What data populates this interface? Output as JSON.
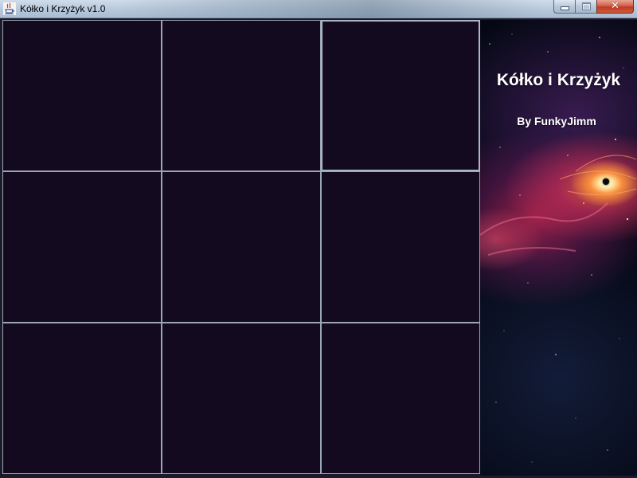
{
  "window": {
    "title": "Kółko i Krzyżyk v1.0",
    "app_icon": "java-cup-icon",
    "caption_buttons": {
      "minimize_icon": "minimize-icon",
      "maximize_icon": "maximize-icon",
      "close_icon": "close-icon",
      "close_glyph": "✕"
    }
  },
  "board": {
    "rows": 3,
    "columns": 3,
    "cells": [
      {
        "row": 1,
        "col": 1,
        "mark": ""
      },
      {
        "row": 1,
        "col": 2,
        "mark": ""
      },
      {
        "row": 1,
        "col": 3,
        "mark": "",
        "focused": true
      },
      {
        "row": 2,
        "col": 1,
        "mark": ""
      },
      {
        "row": 2,
        "col": 2,
        "mark": ""
      },
      {
        "row": 2,
        "col": 3,
        "mark": ""
      },
      {
        "row": 3,
        "col": 1,
        "mark": ""
      },
      {
        "row": 3,
        "col": 2,
        "mark": ""
      },
      {
        "row": 3,
        "col": 3,
        "mark": ""
      }
    ],
    "cell_color": "#140a1f",
    "grid_line_color": "#9aa6b2"
  },
  "side_panel": {
    "title": "Kółko i Krzyżyk",
    "author": "By FunkyJimm",
    "background": "space-nebula-image",
    "text_color": "#ffffff"
  }
}
